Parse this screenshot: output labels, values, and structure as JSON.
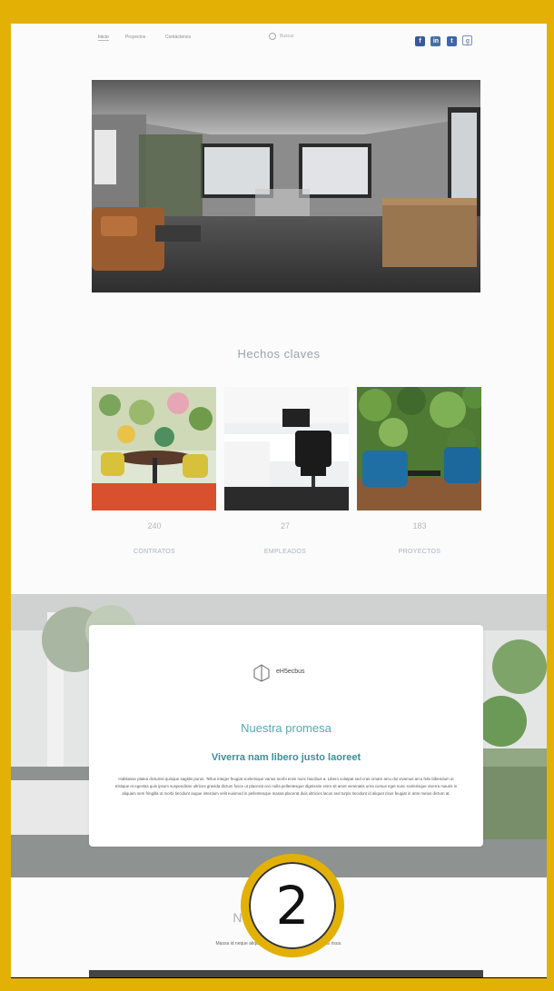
{
  "nav": {
    "items": [
      "Inicio",
      "Proyectos",
      "Contáctenos"
    ],
    "search_placeholder": "Buscar",
    "social": [
      "f",
      "in",
      "t",
      "g"
    ]
  },
  "hero": {
    "image": "modern-loft-office"
  },
  "key_facts": {
    "title": "Hechos claves",
    "stats": [
      {
        "value": "240",
        "label": "CONTRATOS"
      },
      {
        "value": "27",
        "label": "EMPLEADOS"
      },
      {
        "value": "183",
        "label": "PROYECTOS"
      }
    ]
  },
  "promise": {
    "logo_text": "eH5ecbus",
    "title": "Nuestra promesa",
    "subtitle": "Viverra nam libero justo laoreet",
    "body": "Habitasse platea dictumst quisque sagittis purus. Tellus integer feugiat scelerisque varius morbi enim nunc faucibus a. Libero volutpat sed cras ornare arcu dui vivamus arcu felis bibendum ut tristique et egestas quis ipsum suspendisse ultrices gravida dictum fusce ut placerat orci nulla pellentesque dignissim enim sit amet venenatis urna cursus eget nunc scelerisque viverra mauris in aliquam sem fringilla ut morbi tincidunt augue interdum velit euismod in pellentesque massa placerat duis ultricies lacus sed turpis tincidunt id aliquet risus feugiat in ante metus dictum at."
  },
  "bottom": {
    "title": "Nuestro objetivo",
    "text": "Massa id neque aliquam vestibulum morbi blandit cursus risus."
  },
  "overlay": {
    "number": "2"
  },
  "colors": {
    "frame": "#e3b105",
    "accent": "#54a9b6"
  }
}
